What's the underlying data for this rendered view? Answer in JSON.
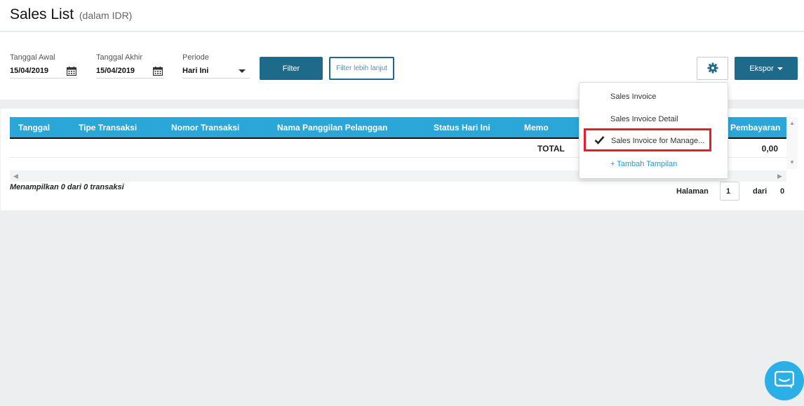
{
  "header": {
    "title": "Sales List",
    "subtitle": "(dalam IDR)"
  },
  "filters": {
    "start": {
      "label": "Tanggal Awal",
      "value": "15/04/2019"
    },
    "end": {
      "label": "Tanggal Akhir",
      "value": "15/04/2019"
    },
    "period": {
      "label": "Periode",
      "value": "Hari Ini"
    },
    "filter_button": "Filter",
    "advanced_button": "Filter lebih lanjut"
  },
  "toolbar": {
    "settings_icon": "gear-icon",
    "export_label": "Ekspor"
  },
  "table": {
    "columns": [
      "Tanggal",
      "Tipe Transaksi",
      "Nomor Transaksi",
      "Nama Panggilan Pelanggan",
      "Status Hari Ini",
      "Memo",
      "Pembayaran"
    ],
    "total_label": "TOTAL",
    "total_value": "0,00"
  },
  "footer": {
    "count_text": "Menampilkan 0 dari 0 transaksi",
    "page_label": "Halaman",
    "page_value": "1",
    "of_label": "dari",
    "total_pages": "0"
  },
  "menu": {
    "items": [
      {
        "label": "Sales Invoice",
        "checked": false
      },
      {
        "label": "Sales Invoice Detail",
        "checked": false
      },
      {
        "label": "Sales Invoice for Manage...",
        "checked": true
      }
    ],
    "add_label": "+ Tambah Tampilan"
  },
  "colors": {
    "primary": "#1e6a8a",
    "table_header": "#2aa6d8",
    "highlight": "#e0202a",
    "link": "#1a9bd6",
    "chat": "#2ab0e6"
  }
}
